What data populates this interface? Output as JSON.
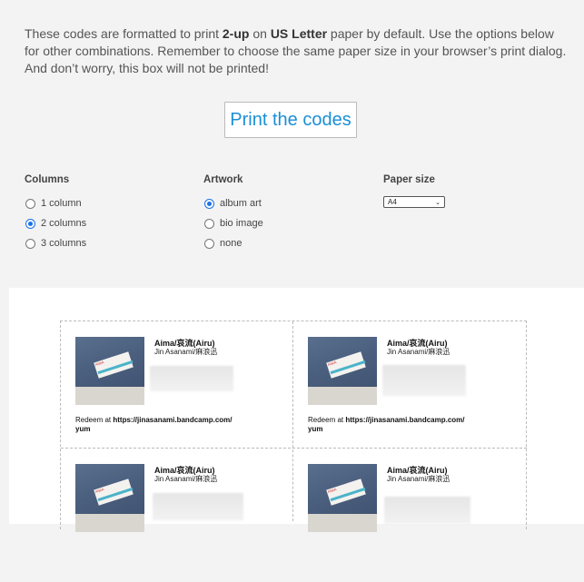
{
  "intro": {
    "p1": "These codes are formatted to print ",
    "b1": "2-up",
    "p2": " on ",
    "b2": "US Letter",
    "p3": " paper by default. Use the options below for other combinations. Remember to choose the same paper size in your browser’s print dialog. And don’t worry, this box will not be printed!"
  },
  "print_button": "Print the codes",
  "options": {
    "columns": {
      "header": "Columns",
      "items": [
        {
          "label": "1 column",
          "checked": false
        },
        {
          "label": "2 columns",
          "checked": true
        },
        {
          "label": "3 columns",
          "checked": false
        }
      ]
    },
    "artwork": {
      "header": "Artwork",
      "items": [
        {
          "label": "album art",
          "checked": true
        },
        {
          "label": "bio image",
          "checked": false
        },
        {
          "label": "none",
          "checked": false
        }
      ]
    },
    "paper_size": {
      "header": "Paper size",
      "selected": "A4",
      "chevron": "⌄"
    }
  },
  "cards": [
    {
      "title": "Aima/哀流(Airu)",
      "artist": "Jin Asanami/麻浪迅",
      "redeem_prefix": "Redeem at ",
      "redeem_url": "https://jinasanami.bandcamp.com/",
      "redeem_tail": "yum"
    },
    {
      "title": "Aima/哀流(Airu)",
      "artist": "Jin Asanami/麻浪迅",
      "redeem_prefix": "Redeem at ",
      "redeem_url": "https://jinasanami.bandcamp.com/",
      "redeem_tail": "yum"
    },
    {
      "title": "Aima/哀流(Airu)",
      "artist": "Jin Asanami/麻浪迅",
      "redeem_prefix": "",
      "redeem_url": "",
      "redeem_tail": ""
    },
    {
      "title": "Aima/哀流(Airu)",
      "artist": "Jin Asanami/麻浪迅",
      "redeem_prefix": "",
      "redeem_url": "",
      "redeem_tail": ""
    }
  ],
  "art_tag_text": "AIMA",
  "colors": {
    "accent": "#1a8fd6",
    "radio_checked": "#1a73e8"
  }
}
